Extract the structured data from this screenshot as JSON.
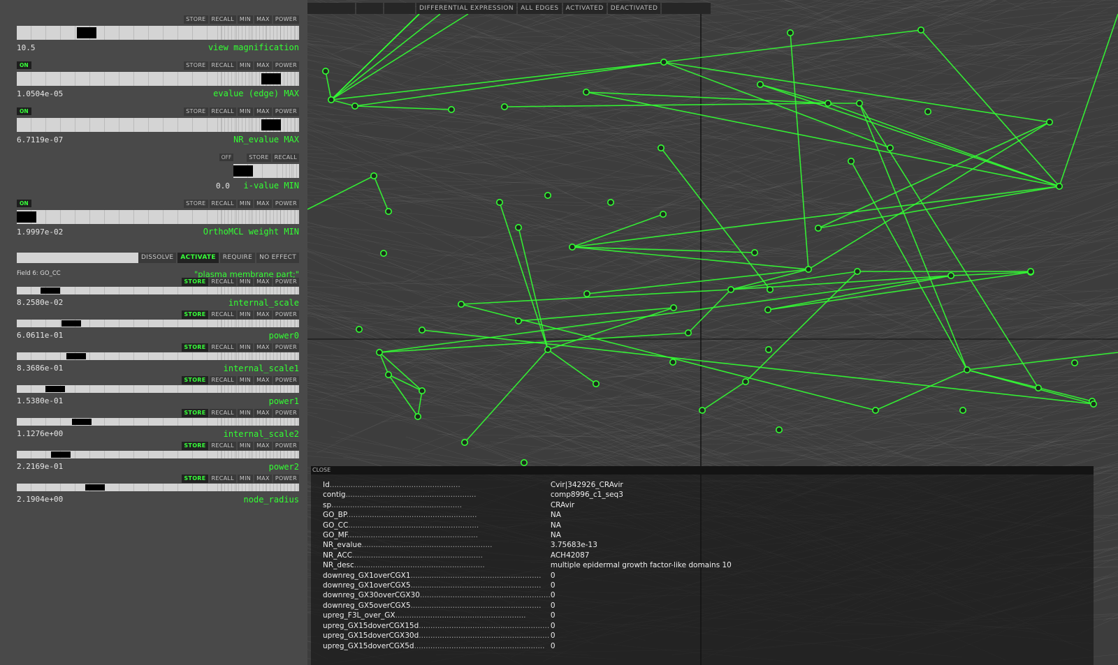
{
  "topbar": {
    "buttons": [
      "",
      "",
      "",
      "DIFFERENTIAL EXPRESSION",
      "ALL EDGES",
      "ACTIVATED",
      "DEACTIVATED",
      ""
    ]
  },
  "button_labels": {
    "store": "STORE",
    "recall": "RECALL",
    "min": "MIN",
    "max": "MAX",
    "power": "POWER",
    "on": "ON",
    "off": "OFF"
  },
  "controls": [
    {
      "id": "view-magnification",
      "label": "view magnification",
      "value": "10.5",
      "badge": "",
      "buttons": [
        "STORE",
        "RECALL",
        "MIN",
        "MAX",
        "POWER"
      ],
      "knob": 0.23
    },
    {
      "id": "evalue-edge-max",
      "label": "evalue (edge) MAX",
      "value": "1.0504e-05",
      "badge": "ON",
      "buttons": [
        "STORE",
        "RECALL",
        "MIN",
        "MAX",
        "POWER"
      ],
      "knob": 0.93
    },
    {
      "id": "nr-evalue-max",
      "label": "NR_evalue MAX",
      "value": "6.7119e-07",
      "badge": "ON",
      "buttons": [
        "STORE",
        "RECALL",
        "MIN",
        "MAX",
        "POWER"
      ],
      "knob": 0.93
    },
    {
      "id": "i-value-min",
      "label": "i-value MIN",
      "value": "0.0",
      "badge": "OFF",
      "buttons": [
        "STORE",
        "RECALL"
      ],
      "knob": 0.0
    },
    {
      "id": "orthomcl-weight-min",
      "label": "OrthoMCL weight MIN",
      "value": "1.9997e-02",
      "badge": "ON",
      "buttons": [
        "STORE",
        "RECALL",
        "MIN",
        "MAX",
        "POWER"
      ],
      "knob": 0.0
    }
  ],
  "go_filter": {
    "buttons": [
      "DISSOLVE",
      "ACTIVATE",
      "REQUIRE",
      "NO EFFECT"
    ],
    "active": "ACTIVATE",
    "field": "Field 6: GO_CC",
    "term": "\"plasma membrane part;\""
  },
  "params": [
    {
      "id": "internal-scale",
      "label": "internal_scale",
      "value": "8.2580e-02",
      "knob": 0.09
    },
    {
      "id": "power0",
      "label": "power0",
      "value": "6.0611e-01",
      "knob": 0.17
    },
    {
      "id": "internal-scale1",
      "label": "internal_scale1",
      "value": "8.3686e-01",
      "knob": 0.19
    },
    {
      "id": "power1",
      "label": "power1",
      "value": "1.5380e-01",
      "knob": 0.11
    },
    {
      "id": "internal-scale2",
      "label": "internal_scale2",
      "value": "1.1276e+00",
      "knob": 0.21
    },
    {
      "id": "power2",
      "label": "power2",
      "value": "2.2169e-01",
      "knob": 0.13
    },
    {
      "id": "node-radius",
      "label": "node_radius",
      "value": "2.1904e+00",
      "knob": 0.26
    }
  ],
  "info": {
    "close_label": "CLOSE",
    "rows": [
      {
        "key": "Id",
        "value": "Cvir|342926_CRAvir"
      },
      {
        "key": "contig",
        "value": "comp8996_c1_seq3"
      },
      {
        "key": "sp",
        "value": "CRAvir"
      },
      {
        "key": "GO_BP",
        "value": "NA"
      },
      {
        "key": "GO_CC",
        "value": "NA"
      },
      {
        "key": "GO_MF",
        "value": "NA"
      },
      {
        "key": "NR_evalue",
        "value": "3.75683e-13"
      },
      {
        "key": "NR_ACC",
        "value": "ACH42087"
      },
      {
        "key": "NR_desc",
        "value": "multiple epidermal growth factor-like domains 10"
      },
      {
        "key": "downreg_GX1overCGX1",
        "value": "0"
      },
      {
        "key": "downreg_GX1overCGX5",
        "value": "0"
      },
      {
        "key": "downreg_GX30overCGX30",
        "value": "0"
      },
      {
        "key": "downreg_GX5overCGX5",
        "value": "0"
      },
      {
        "key": "upreg_F3L_over_GX",
        "value": "0"
      },
      {
        "key": "upreg_GX15doverCGX15d",
        "value": "0"
      },
      {
        "key": "upreg_GX15doverCGX30d",
        "value": "0"
      },
      {
        "key": "upreg_GX15doverCGX5d",
        "value": "0"
      }
    ]
  },
  "colors": {
    "green": "#33ff33",
    "graph_bg": "#3d3d3d",
    "panel_bg": "#494949"
  }
}
